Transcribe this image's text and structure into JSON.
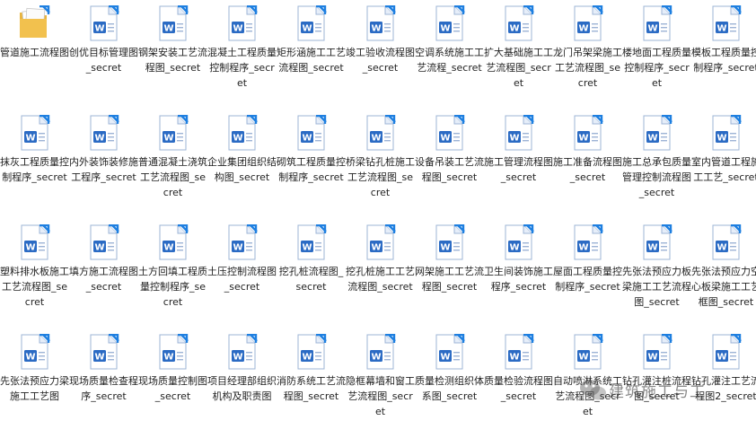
{
  "files": [
    {
      "name": "管道施工流程图",
      "type": "folder"
    },
    {
      "name": "创优目标管理图_secret",
      "type": "word"
    },
    {
      "name": "钢架安装工艺流程图_secret",
      "type": "word"
    },
    {
      "name": "混凝土工程质量控制程序_secret",
      "type": "word"
    },
    {
      "name": "矩形涵施工工艺流程图_secret",
      "type": "word"
    },
    {
      "name": "竣工验收流程图_secret",
      "type": "word"
    },
    {
      "name": "空调系统施工工艺流程_secret",
      "type": "word"
    },
    {
      "name": "扩大基础施工工艺流程图_secret",
      "type": "word"
    },
    {
      "name": "龙门吊架梁施工工艺流程图_secret",
      "type": "word"
    },
    {
      "name": "楼地面工程质量控制程序_secret",
      "type": "word"
    },
    {
      "name": "模板工程质量控制程序_secret",
      "type": "word"
    },
    {
      "name": "抹灰工程质量控制程序_secret",
      "type": "word"
    },
    {
      "name": "内外装饰装修施工程序_secret",
      "type": "word"
    },
    {
      "name": "普通混凝土浇筑工艺流程图_secret",
      "type": "word"
    },
    {
      "name": "企业集团组织结构图_secret",
      "type": "word"
    },
    {
      "name": "砌筑工程质量控制程序_secret",
      "type": "word"
    },
    {
      "name": "桥梁钻孔桩施工工艺流程图_secret",
      "type": "word"
    },
    {
      "name": "设备吊装工艺流程图_secret",
      "type": "word"
    },
    {
      "name": "施工管理流程图_secret",
      "type": "word"
    },
    {
      "name": "施工准备流程图_secret",
      "type": "word"
    },
    {
      "name": "施工总承包质量管理控制流程图_secret",
      "type": "word"
    },
    {
      "name": "室内管道工程施工工艺_secret",
      "type": "word"
    },
    {
      "name": "塑料排水板施工工艺流程图_secret",
      "type": "word"
    },
    {
      "name": "填方施工流程图_secret",
      "type": "word"
    },
    {
      "name": "土方回填工程质量控制程序_secret",
      "type": "word"
    },
    {
      "name": "土压控制流程图_secret",
      "type": "word"
    },
    {
      "name": "挖孔桩流程图_secret",
      "type": "word"
    },
    {
      "name": "挖孔桩施工工艺流程图_secret",
      "type": "word"
    },
    {
      "name": "网架施工工艺流程图_secret",
      "type": "word"
    },
    {
      "name": "卫生间装饰施工程序_secret",
      "type": "word"
    },
    {
      "name": "屋面工程质量控制程序_secret",
      "type": "word"
    },
    {
      "name": "先张法预应力板梁施工工艺流程图_secret",
      "type": "word"
    },
    {
      "name": "先张法预应力空心板梁施工工艺框图_secret",
      "type": "word"
    },
    {
      "name": "先张法预应力梁施工工艺图",
      "type": "word"
    },
    {
      "name": "现场质量检查程序_secret",
      "type": "word"
    },
    {
      "name": "现场质量控制图_secret",
      "type": "word"
    },
    {
      "name": "项目经理部组织机构及职责图",
      "type": "word"
    },
    {
      "name": "消防系统工艺流程图_secret",
      "type": "word"
    },
    {
      "name": "隐框幕墙和窗工艺流程图_secret",
      "type": "word"
    },
    {
      "name": "质量检测组织体系图_secret",
      "type": "word"
    },
    {
      "name": "质量检验流程图_secret",
      "type": "word"
    },
    {
      "name": "自动喷淋系统工艺流程图_secret",
      "type": "word"
    },
    {
      "name": "钻孔灌注桩流程图_secret",
      "type": "word"
    },
    {
      "name": "钻孔灌注工艺流程图2_secret",
      "type": "word"
    }
  ],
  "watermark": {
    "text": "建筑施工与工"
  },
  "colors": {
    "word_blue": "#2b6bc4",
    "folder_yellow": "#f2c14e",
    "arrow_blue": "#1e7fe0"
  }
}
